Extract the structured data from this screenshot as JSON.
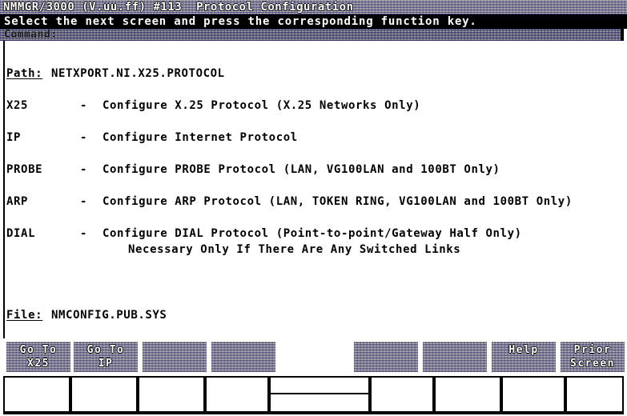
{
  "title_bar": {
    "text": "NMMGR/3000 (V.uu.ff) #113  Protocol Configuration"
  },
  "instruction_bar": {
    "text": "Select the next screen and press the corresponding function key."
  },
  "command_bar": {
    "label": "Command:",
    "value": ""
  },
  "path": {
    "label": "Path:",
    "value": "NETXPORT.NI.X25.PROTOCOL"
  },
  "menu": {
    "items": [
      {
        "key": "X25",
        "dash": "-",
        "description": "Configure X.25 Protocol (X.25 Networks Only)",
        "continuation": ""
      },
      {
        "key": "IP",
        "dash": "-",
        "description": "Configure Internet Protocol",
        "continuation": ""
      },
      {
        "key": "PROBE",
        "dash": "-",
        "description": "Configure PROBE Protocol (LAN, VG100LAN and 100BT Only)",
        "continuation": ""
      },
      {
        "key": "ARP",
        "dash": "-",
        "description": "Configure ARP Protocol (LAN, TOKEN RING, VG100LAN and 100BT Only)",
        "continuation": ""
      },
      {
        "key": "DIAL",
        "dash": "-",
        "description": "Configure DIAL Protocol (Point-to-point/Gateway Half Only)",
        "continuation": "Necessary Only If There Are Any Switched Links"
      }
    ]
  },
  "file": {
    "label": "File:",
    "value": "NMCONFIG.PUB.SYS"
  },
  "function_keys": [
    {
      "line1": "Go To",
      "line2": "X25"
    },
    {
      "line1": "Go To",
      "line2": "IP"
    },
    {
      "line1": "",
      "line2": ""
    },
    {
      "line1": "",
      "line2": ""
    },
    {
      "line1": "",
      "line2": ""
    },
    {
      "line1": "",
      "line2": ""
    },
    {
      "line1": "Help",
      "line2": ""
    },
    {
      "line1": "Prior",
      "line2": "Screen"
    }
  ],
  "colors": {
    "screen_background": "#ffffff",
    "text": "#000000",
    "inverse_background": "#000000",
    "inverse_text": "#ffffff",
    "dither_blue": "#3c3c78",
    "dither_olive": "#a8a46e"
  }
}
